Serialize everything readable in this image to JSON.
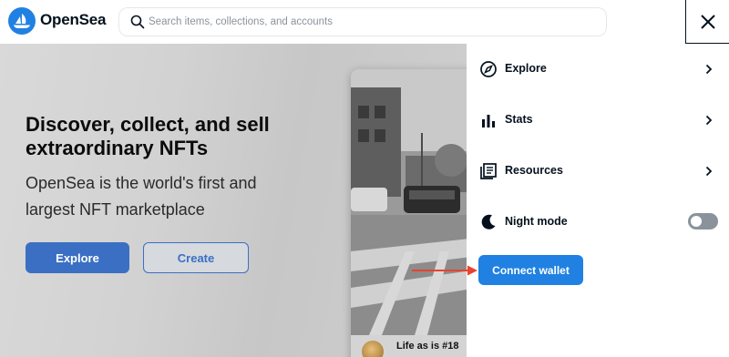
{
  "header": {
    "brand": "OpenSea",
    "search_placeholder": "Search items, collections, and accounts"
  },
  "hero": {
    "title": "Discover, collect, and sell extraordinary NFTs",
    "subtitle": "OpenSea is the world's first and largest NFT marketplace",
    "explore_label": "Explore",
    "create_label": "Create",
    "card_name": "Life as is #18"
  },
  "menu": {
    "items": [
      {
        "label": "Explore",
        "icon": "compass-icon"
      },
      {
        "label": "Stats",
        "icon": "bar-chart-icon"
      },
      {
        "label": "Resources",
        "icon": "document-icon"
      },
      {
        "label": "Night mode",
        "icon": "moon-icon"
      }
    ],
    "night_mode_on": false,
    "connect_wallet_label": "Connect wallet"
  },
  "colors": {
    "brand_blue": "#2081e2",
    "text_dark": "#04111d",
    "annotation_arrow": "#e8432e"
  }
}
